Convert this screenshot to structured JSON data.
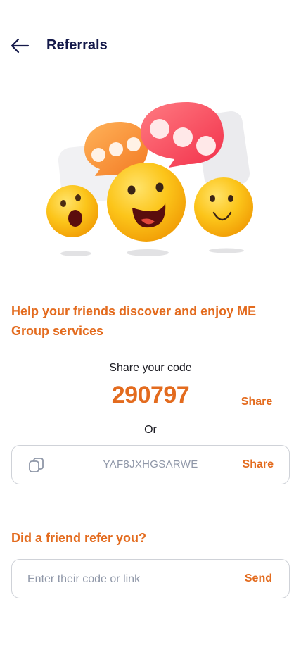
{
  "header": {
    "back_icon": "arrow-left-icon",
    "title": "Referrals"
  },
  "illustration": {
    "name": "emoji-chat-illustration"
  },
  "headline": "Help your friends discover and enjoy ME Group services",
  "share_code": {
    "label": "Share your code",
    "code": "290797",
    "share_label": "Share"
  },
  "or_label": "Or",
  "share_link": {
    "copy_icon": "copy-icon",
    "link_code": "YAF8JXHGSARWE",
    "share_label": "Share"
  },
  "refer": {
    "title": "Did a friend refer you?",
    "input_placeholder": "Enter their code or link",
    "input_value": "",
    "send_label": "Send"
  },
  "colors": {
    "accent": "#e36b1e",
    "title": "#14194a",
    "muted": "#8f97a8",
    "border": "#cfd2d8"
  }
}
